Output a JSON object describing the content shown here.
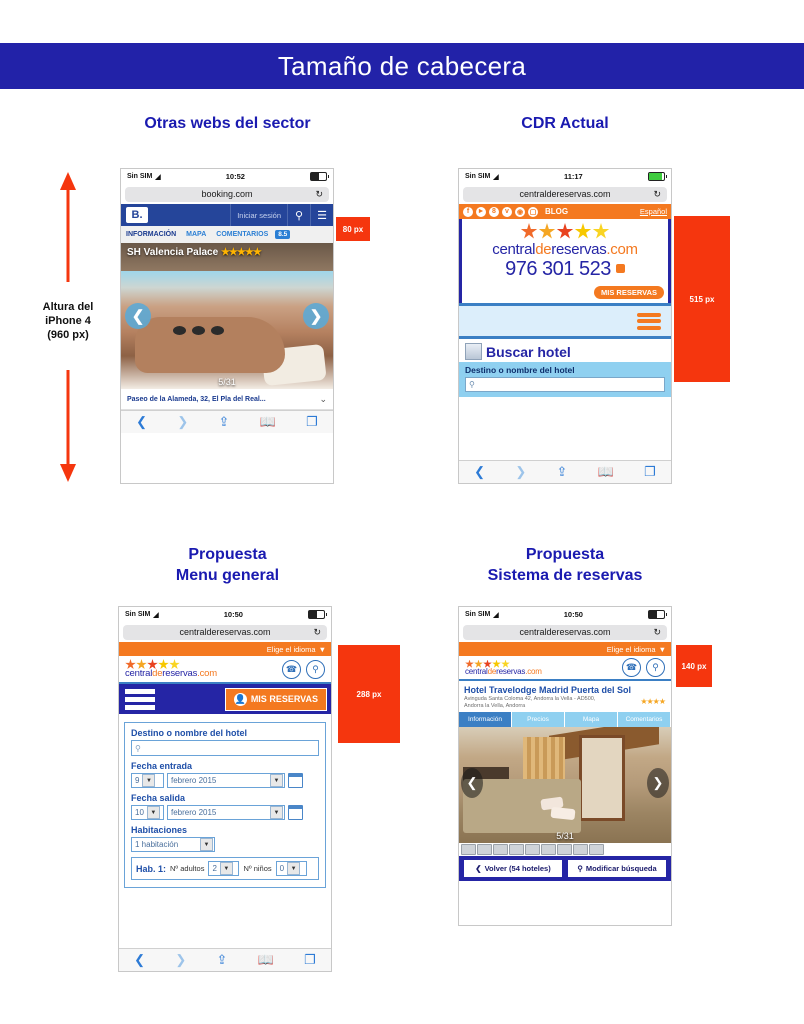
{
  "banner": {
    "title": "Tamaño de cabecera"
  },
  "sections": {
    "top_left_title": "Otras webs del sector",
    "top_right_title": "CDR Actual",
    "bottom_left_title_1": "Propuesta",
    "bottom_left_title_2": "Menu general",
    "bottom_right_title_1": "Propuesta",
    "bottom_right_title_2": "Sistema de reservas"
  },
  "annotation": {
    "line1": "Altura del",
    "line2": "iPhone 4",
    "line3": "(960 px)",
    "arrow_color": "#f5360e"
  },
  "measures": {
    "booking": "80 px",
    "cdr_actual": "515 px",
    "menu_general": "288 px",
    "reservas": "140 px",
    "color": "#f5360e"
  },
  "phone_booking": {
    "status": {
      "carrier": "Sin SIM",
      "wifi": "wifi-icon",
      "time": "10:52",
      "battery": "battery-icon"
    },
    "url": "booking.com",
    "reload": "reload-icon",
    "nav": {
      "logo": "B.",
      "login": "Iniciar sesión",
      "search": "search-icon",
      "menu": "menu-icon"
    },
    "tabs": [
      {
        "label": "INFORMACIÓN",
        "active": true
      },
      {
        "label": "MAPA",
        "active": false
      },
      {
        "label": "COMENTARIOS",
        "active": false
      }
    ],
    "score": "8.5",
    "hotel_name": "SH Valencia Palace",
    "hotel_stars": "★★★★★",
    "photo_counter": "5/31",
    "address": "Paseo de la Alameda, 32, El Pla del Real...",
    "toolbar": [
      "back-icon",
      "forward-icon",
      "share-icon",
      "bookmarks-icon",
      "tabs-icon"
    ]
  },
  "phone_cdr_actual": {
    "status": {
      "carrier": "Sin SIM",
      "time": "11:17"
    },
    "url": "centraldereservas.com",
    "social": {
      "icons": [
        "facebook-icon",
        "twitter-icon",
        "google-plus-icon",
        "vimeo-icon",
        "instagram-icon",
        "rss-icon"
      ],
      "blog": "BLOG",
      "lang": "Español"
    },
    "brand_part1": "central",
    "brand_part2": "de",
    "brand_part3": "reservas",
    "brand_part4": ".com",
    "phone_number": "976 301 523",
    "my_bookings": "MIS RESERVAS",
    "search_title": "Buscar hotel",
    "destination_label": "Destino o nombre del hotel"
  },
  "phone_menu_general": {
    "status": {
      "carrier": "Sin SIM",
      "time": "10:50"
    },
    "url": "centraldereservas.com",
    "lang_select": "Elige el idioma",
    "brand": "centraldereservas.com",
    "icons": [
      "phone-icon",
      "search-icon"
    ],
    "menu_button": "hamburger-icon",
    "my_bookings": "MIS RESERVAS",
    "form": {
      "destination_label": "Destino o nombre del hotel",
      "destination_placeholder": "",
      "checkin_label": "Fecha entrada",
      "checkin_day": "9",
      "checkin_month": "febrero 2015",
      "checkout_label": "Fecha salida",
      "checkout_day": "10",
      "checkout_month": "febrero 2015",
      "rooms_label": "Habitaciones",
      "rooms_value": "1 habitación",
      "room_tag": "Hab. 1:",
      "adults_label": "Nº adultos",
      "adults_value": "2",
      "children_label": "Nº niños",
      "children_value": "0"
    }
  },
  "phone_reservas": {
    "status": {
      "carrier": "Sin SIM",
      "time": "10:50"
    },
    "url": "centraldereservas.com",
    "lang_select": "Elige el idioma",
    "brand": "centraldereservas.com",
    "hotel_name": "Hotel Travelodge Madrid Puerta del Sol",
    "hotel_address": "Avinguda Santa Coloma 42, Andorra la Vella - AD500, Andorra la Vella, Andorra",
    "hotel_stars": "★★★★",
    "tabs": [
      {
        "label": "Información",
        "active": true
      },
      {
        "label": "Precios",
        "active": false
      },
      {
        "label": "Mapa",
        "active": false
      },
      {
        "label": "Comentarios",
        "active": false
      }
    ],
    "photo_counter": "5/31",
    "back_button": "Volver (54 hoteles)",
    "modify_button": "Modificar búsqueda"
  }
}
